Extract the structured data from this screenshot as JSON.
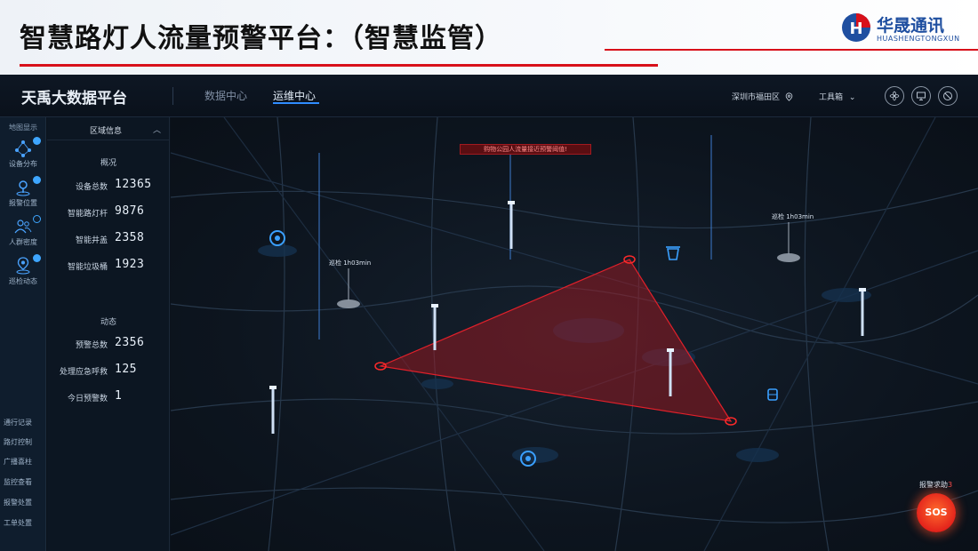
{
  "slide": {
    "title": "智慧路灯人流量预警平台：（智慧监管）",
    "logo_cn": "华晟通讯",
    "logo_en": "HUASHENGTONGXUN",
    "logo_mark_letter": "H"
  },
  "header": {
    "app_title": "天禹大数据平台",
    "tabs": [
      {
        "label": "数据中心",
        "active": false
      },
      {
        "label": "运维中心",
        "active": true
      }
    ],
    "location": "深圳市福田区",
    "tools_label": "工具箱",
    "round_icons": [
      "fan-icon",
      "monitor-icon",
      "block-icon"
    ]
  },
  "left_nav": {
    "header": "地图显示",
    "items": [
      {
        "label": "设备分布",
        "icon": "nodes-icon",
        "checked": true
      },
      {
        "label": "报警位置",
        "icon": "pin-icon",
        "checked": true
      },
      {
        "label": "人群密度",
        "icon": "crowd-icon",
        "checked": false
      },
      {
        "label": "巡检动态",
        "icon": "location-icon",
        "checked": true
      }
    ],
    "links": [
      "通行记录",
      "路灯控制",
      "广播喜柱",
      "监控查看",
      "报警处置",
      "工单处置"
    ]
  },
  "stats": {
    "panel_title": "区域信息",
    "overview_title": "概况",
    "overview": [
      {
        "label": "设备总数",
        "value": "12365"
      },
      {
        "label": "智能路灯杆",
        "value": "9876"
      },
      {
        "label": "智能井盖",
        "value": "2358"
      },
      {
        "label": "智能垃圾桶",
        "value": "1923"
      }
    ],
    "dynamic_title": "动态",
    "dynamic": [
      {
        "label": "预警总数",
        "value": "2356"
      },
      {
        "label": "处理应急呼救",
        "value": "125"
      },
      {
        "label": "今日预警数",
        "value": "1"
      }
    ]
  },
  "map": {
    "alert_text": "购物公园人流量接近预警阈值!",
    "patrol_labels": [
      "巡检 1h03min",
      "巡检 1h03min"
    ],
    "sos_label": "报警求助",
    "sos_count": "3",
    "sos_button": "SOS",
    "colors": {
      "alert": "#e0202a",
      "zone_fill": "#b0181e",
      "pole": "#cfe0f5",
      "marker": "#3aa0ff"
    }
  }
}
